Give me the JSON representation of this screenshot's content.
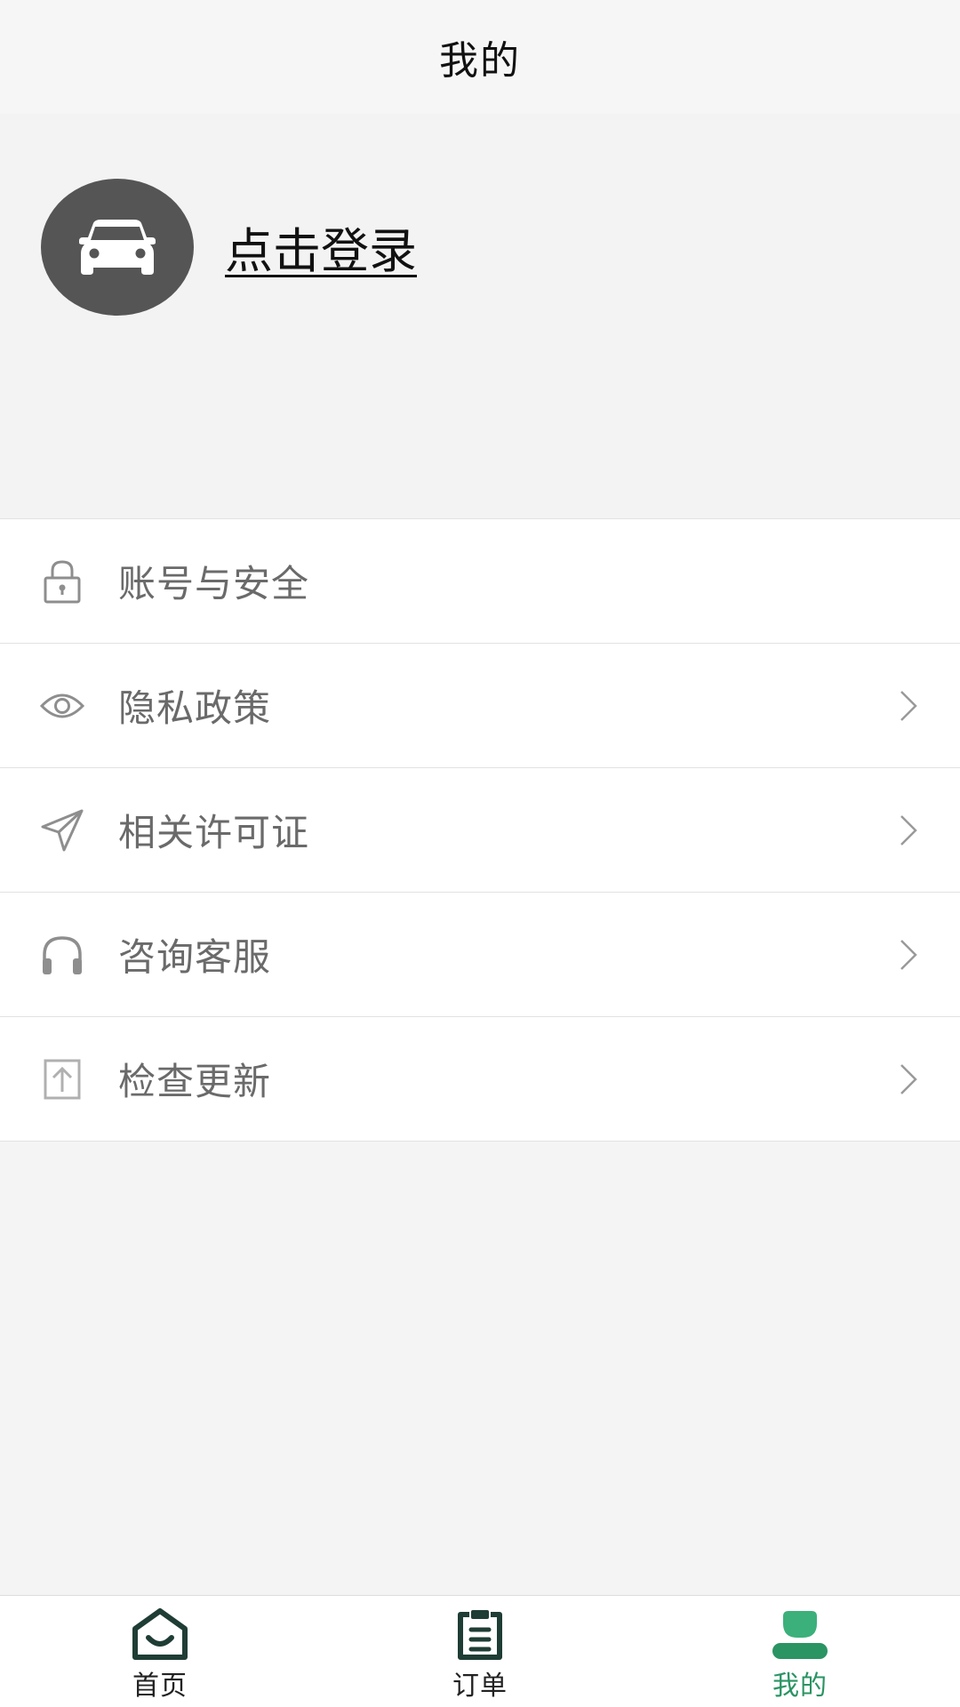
{
  "header": {
    "title": "我的"
  },
  "profile": {
    "avatar_icon": "car-icon",
    "login_label": "点击登录"
  },
  "menu": {
    "items": [
      {
        "label": "账号与安全",
        "icon": "lock-icon",
        "has_chevron": false
      },
      {
        "label": "隐私政策",
        "icon": "eye-icon",
        "has_chevron": true
      },
      {
        "label": "相关许可证",
        "icon": "send-icon",
        "has_chevron": true
      },
      {
        "label": "咨询客服",
        "icon": "headphones-icon",
        "has_chevron": true
      },
      {
        "label": "检查更新",
        "icon": "upload-icon",
        "has_chevron": true
      }
    ]
  },
  "tabbar": {
    "tabs": [
      {
        "label": "首页",
        "icon": "home-icon",
        "active": false
      },
      {
        "label": "订单",
        "icon": "clipboard-icon",
        "active": false
      },
      {
        "label": "我的",
        "icon": "user-icon",
        "active": true
      }
    ]
  },
  "colors": {
    "accent": "#2a9463",
    "tab_icon_dark": "#1f3d35",
    "avatar_bg": "#555555",
    "menu_text": "#6a6a6a",
    "icon_gray": "#8e8e8e"
  }
}
